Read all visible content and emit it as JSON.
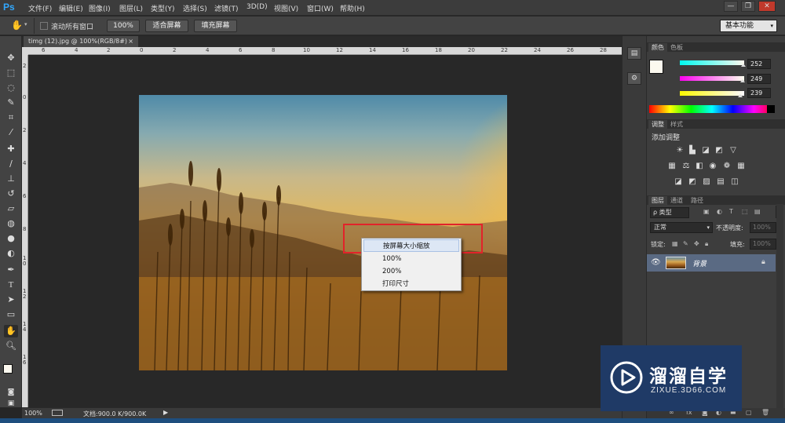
{
  "app": {
    "logo": "Ps"
  },
  "menubar": {
    "items": [
      "文件(F)",
      "编辑(E)",
      "图像(I)",
      "图层(L)",
      "类型(Y)",
      "选择(S)",
      "滤镜(T)",
      "3D(D)",
      "视图(V)",
      "窗口(W)",
      "帮助(H)"
    ],
    "window_buttons": [
      "—",
      "❐",
      "✕"
    ]
  },
  "options": {
    "tool_symbol": "✋",
    "scroll_all_label": "滚动所有窗口",
    "buttons": [
      "100%",
      "适合屏幕",
      "填充屏幕"
    ],
    "workspace": "基本功能"
  },
  "document": {
    "tab_title": "timg (12).jpg @ 100%(RGB/8#)",
    "tab_close": "×"
  },
  "ruler": {
    "h_labels": [
      "6",
      "4",
      "2",
      "0",
      "2",
      "4",
      "6",
      "8",
      "10",
      "12",
      "14",
      "16",
      "18",
      "20",
      "22",
      "24",
      "26",
      "28"
    ],
    "v_labels": [
      "2",
      "0",
      "2",
      "4",
      "6",
      "8",
      "1\n0",
      "1\n2",
      "1\n4",
      "1\n6"
    ]
  },
  "status": {
    "zoom": "100%",
    "doc_info": "文档:900.0 K/900.0K"
  },
  "context_menu": {
    "items": [
      "按屏幕大小缩放",
      "100%",
      "200%",
      "打印尺寸"
    ],
    "highlighted_index": 0
  },
  "panels": {
    "color": {
      "tabs": [
        "颜色",
        "色板"
      ],
      "channels": [
        {
          "label": "R",
          "value": "252",
          "fraction": 0.988,
          "gradient": "linear-gradient(90deg,#00f9ef,#fff9ef)"
        },
        {
          "label": "G",
          "value": "249",
          "fraction": 0.976,
          "gradient": "linear-gradient(90deg,#fc00ef,#fcffef)"
        },
        {
          "label": "B",
          "value": "239",
          "fraction": 0.937,
          "gradient": "linear-gradient(90deg,#fcf900,#fcf9ff)"
        }
      ]
    },
    "adjustments": {
      "tabs": [
        "调整",
        "样式"
      ],
      "title": "添加调整"
    },
    "layers": {
      "tabs": [
        "图层",
        "通道",
        "路径"
      ],
      "filter_label": "ρ 类型",
      "blend_mode": "正常",
      "opacity_label": "不透明度:",
      "opacity_value": "100%",
      "lock_label": "锁定:",
      "fill_label": "填充:",
      "fill_value": "100%",
      "layer_name": "背景"
    }
  },
  "watermark": {
    "brand": "溜溜自学",
    "url": "ZIXUE.3D66.COM"
  }
}
